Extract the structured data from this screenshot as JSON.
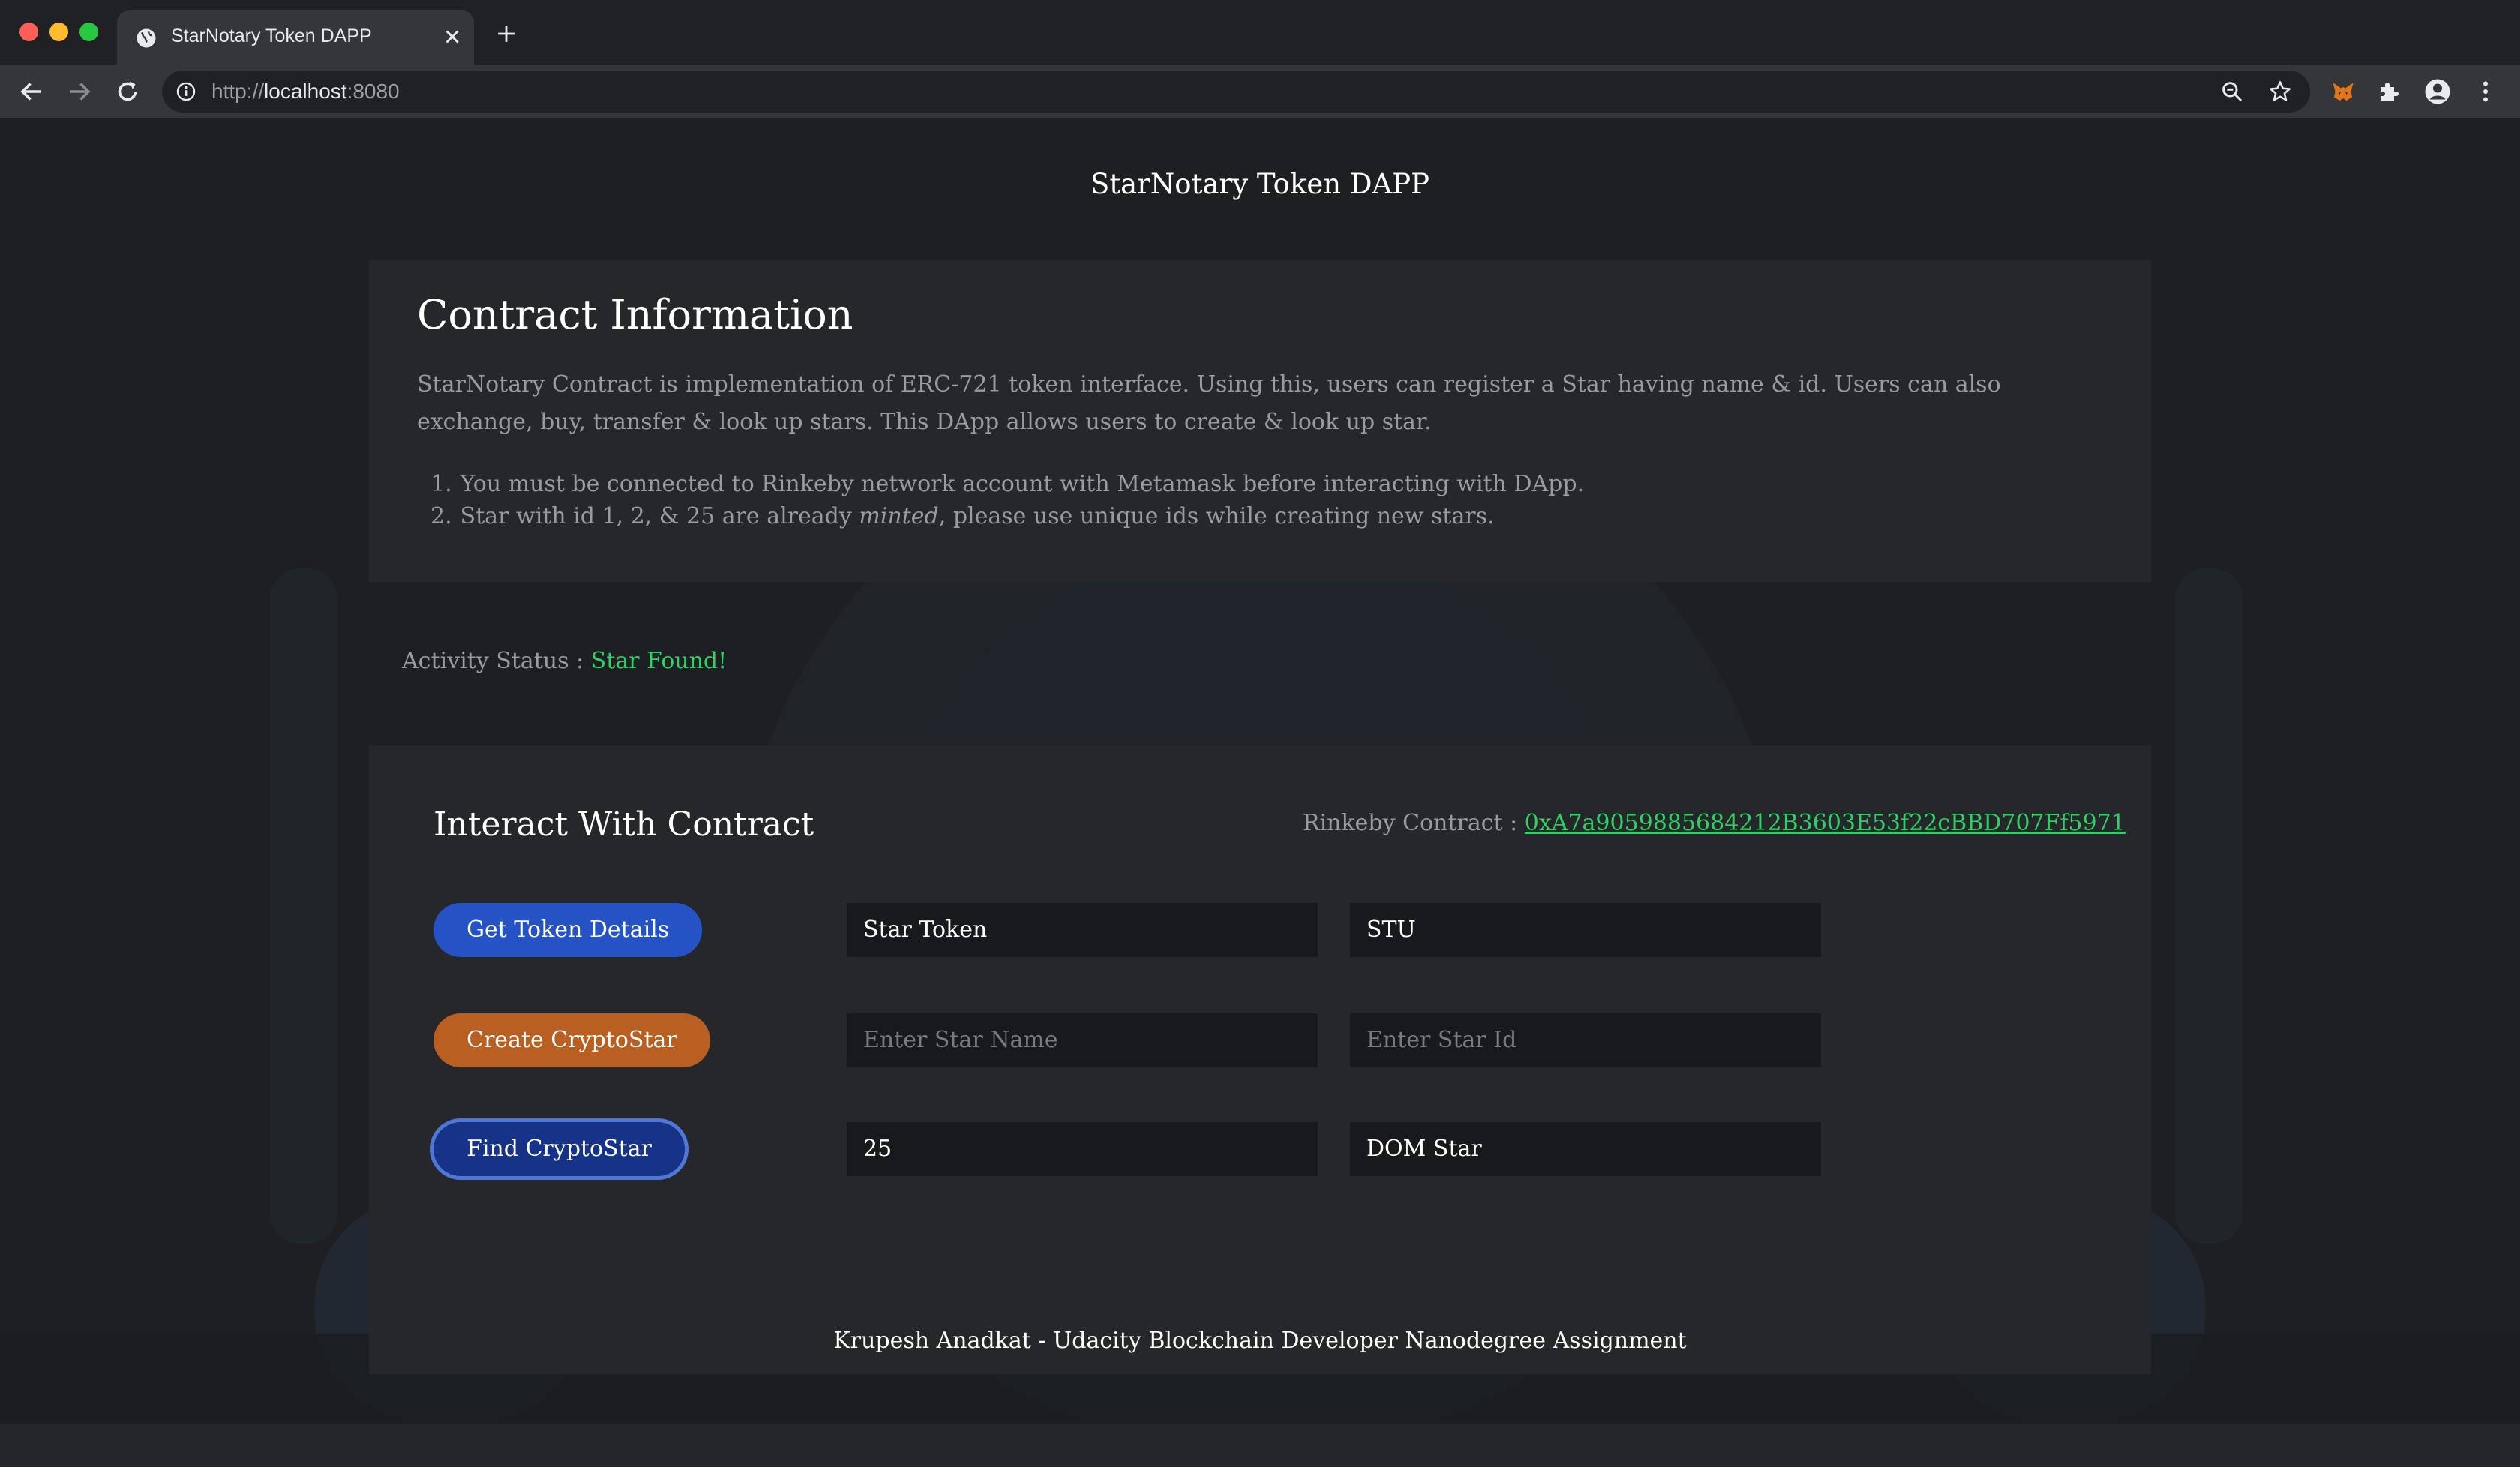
{
  "browser": {
    "tab_title": "StarNotary Token DAPP",
    "url_scheme": "http://",
    "url_host": "localhost",
    "url_port": ":8080"
  },
  "page": {
    "site_title": "StarNotary Token DAPP",
    "contract_info": {
      "heading": "Contract Information",
      "description": "StarNotary Contract is implementation of ERC-721 token interface. Using this, users can register a Star having name & id. Users can also exchange, buy, transfer & look up stars. This DApp allows users to create & look up star.",
      "notes": [
        {
          "num": "1.",
          "text": "You must be connected to Rinkeby network account with Metamask before interacting with DApp."
        },
        {
          "num": "2.",
          "pre": "Star with id 1, 2, & 25 are already ",
          "em": "minted",
          "post": ", please use unique ids while creating new stars."
        }
      ]
    },
    "status": {
      "label": "Activity Status : ",
      "value": "Star Found!"
    },
    "interact": {
      "heading": "Interact With Contract",
      "contract_label": "Rinkeby Contract : ",
      "contract_address": "0xA7a9059885684212B3603E53f22cBBD707Ff5971",
      "rows": [
        {
          "button": "Get Token Details",
          "field1_value": "Star Token",
          "field2_value": "STU"
        },
        {
          "button": "Create CryptoStar",
          "field1_placeholder": "Enter Star Name",
          "field2_placeholder": "Enter Star Id"
        },
        {
          "button": "Find CryptoStar",
          "field1_value": "25",
          "field2_value": "DOM Star"
        }
      ]
    },
    "footer": "Krupesh Anadkat - Udacity Blockchain Developer Nanodegree Assignment"
  },
  "colors": {
    "accent_green": "#2fd165",
    "button_blue": "#2553c6",
    "button_orange": "#b85f21",
    "button_navy": "#173387"
  }
}
